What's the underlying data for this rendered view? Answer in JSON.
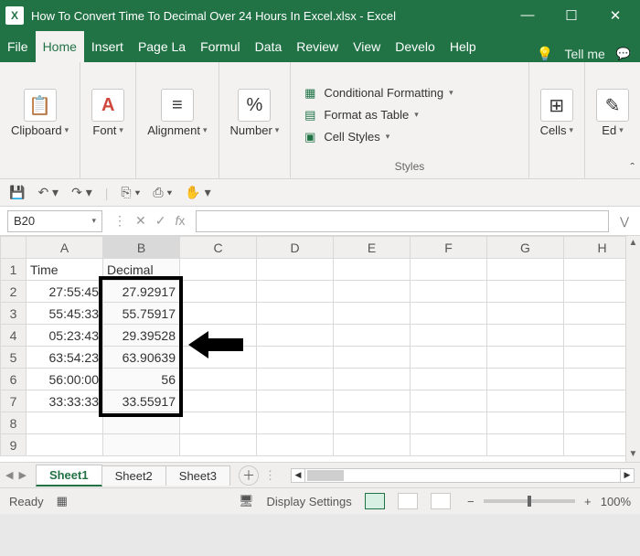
{
  "title": "How To Convert Time To Decimal Over 24 Hours In Excel.xlsx  -  Excel",
  "menu": {
    "tabs": [
      "File",
      "Home",
      "Insert",
      "Page La",
      "Formul",
      "Data",
      "Review",
      "View",
      "Develo",
      "Help"
    ],
    "active": "Home",
    "tellme": "Tell me"
  },
  "ribbon": {
    "clipboard": "Clipboard",
    "font": "Font",
    "alignment": "Alignment",
    "number": "Number",
    "styles_label": "Styles",
    "cond_fmt": "Conditional Formatting",
    "as_table": "Format as Table",
    "cell_styles": "Cell Styles",
    "cells": "Cells",
    "editing": "Ed"
  },
  "namebox": "B20",
  "formula": "",
  "columns": [
    "A",
    "B",
    "C",
    "D",
    "E",
    "F",
    "G",
    "H"
  ],
  "headers": {
    "A": "Time",
    "B": "Decimal"
  },
  "rows": [
    {
      "n": "1"
    },
    {
      "n": "2",
      "A": "27:55:45",
      "B": "27.92917"
    },
    {
      "n": "3",
      "A": "55:45:33",
      "B": "55.75917"
    },
    {
      "n": "4",
      "A": "05:23:43",
      "B": "29.39528"
    },
    {
      "n": "5",
      "A": "63:54:23",
      "B": "63.90639"
    },
    {
      "n": "6",
      "A": "56:00:00",
      "B": "56"
    },
    {
      "n": "7",
      "A": "33:33:33",
      "B": "33.55917"
    },
    {
      "n": "8"
    },
    {
      "n": "9"
    }
  ],
  "sheets": [
    "Sheet1",
    "Sheet2",
    "Sheet3"
  ],
  "active_sheet": "Sheet1",
  "status": {
    "ready": "Ready",
    "display": "Display Settings",
    "zoom": "100%"
  },
  "chart_data": {
    "type": "table",
    "columns": [
      "Time",
      "Decimal"
    ],
    "data": [
      [
        "27:55:45",
        27.92917
      ],
      [
        "55:45:33",
        55.75917
      ],
      [
        "05:23:43",
        29.39528
      ],
      [
        "63:54:23",
        63.90639
      ],
      [
        "56:00:00",
        56
      ],
      [
        "33:33:33",
        33.55917
      ]
    ]
  }
}
